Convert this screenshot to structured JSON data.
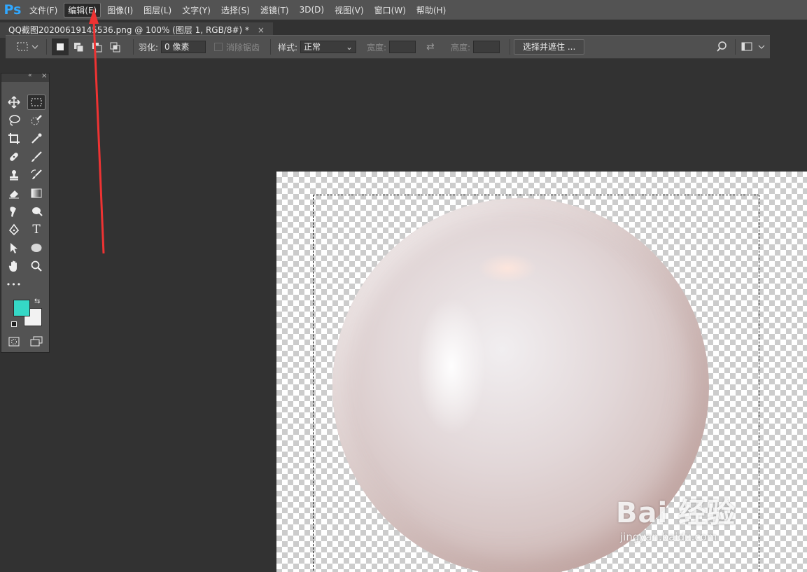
{
  "app": {
    "logo": "Ps"
  },
  "menu": [
    "文件(F)",
    "编辑(E)",
    "图像(I)",
    "图层(L)",
    "文字(Y)",
    "选择(S)",
    "滤镜(T)",
    "3D(D)",
    "视图(V)",
    "窗口(W)",
    "帮助(H)"
  ],
  "menu_active": "编辑(E)",
  "document_tab": {
    "title": "QQ截图20200619145536.png @ 100% (图层 1, RGB/8#) *",
    "close": "×"
  },
  "options": {
    "feather_label": "羽化:",
    "feather_value": "0 像素",
    "antialias_label": "消除锯齿",
    "style_label": "样式:",
    "style_value": "正常",
    "width_label": "宽度:",
    "height_label": "高度:",
    "select_mask_button": "选择并遮住 ..."
  },
  "toolbox": {
    "foreground_color": "#35d8c6",
    "background_color": "#f2f2f2",
    "more_label": "•••",
    "type_tool_label": "T"
  },
  "watermark": {
    "main": "Bai 经验",
    "sub": "jingyan.baidu.com"
  },
  "annotation": {
    "arrow_color": "#ee3333"
  }
}
